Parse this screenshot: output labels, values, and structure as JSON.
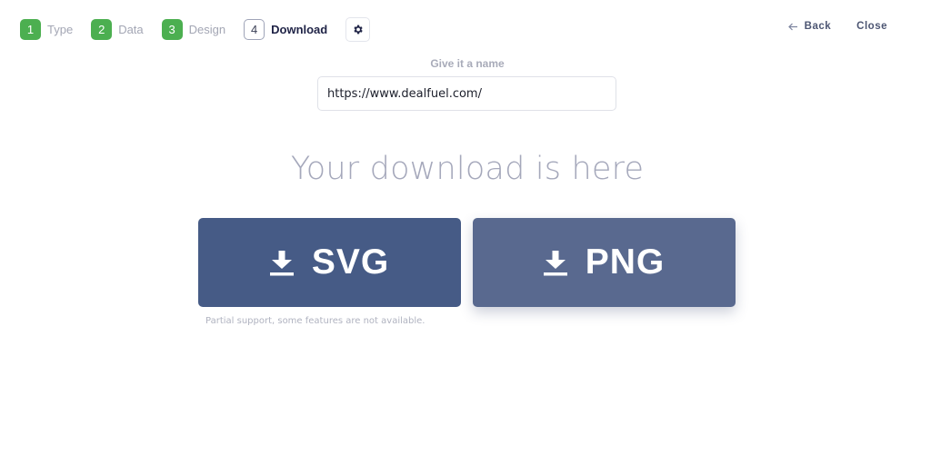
{
  "steps": [
    {
      "num": "1",
      "label": "Type"
    },
    {
      "num": "2",
      "label": "Data"
    },
    {
      "num": "3",
      "label": "Design"
    },
    {
      "num": "4",
      "label": "Download"
    }
  ],
  "nav": {
    "back": "Back",
    "close": "Close"
  },
  "name_section": {
    "label": "Give it a name",
    "value": "https://www.dealfuel.com/"
  },
  "headline": "Your download is here",
  "downloads": {
    "svg_label": "SVG",
    "png_label": "PNG"
  },
  "note": "Partial support, some features are not available.",
  "colors": {
    "step_complete": "#4caf50",
    "svg_button": "#465b86",
    "png_button": "#59698f"
  },
  "icons": {
    "settings": "gear-icon",
    "back": "arrow-left-icon",
    "download": "download-icon"
  }
}
